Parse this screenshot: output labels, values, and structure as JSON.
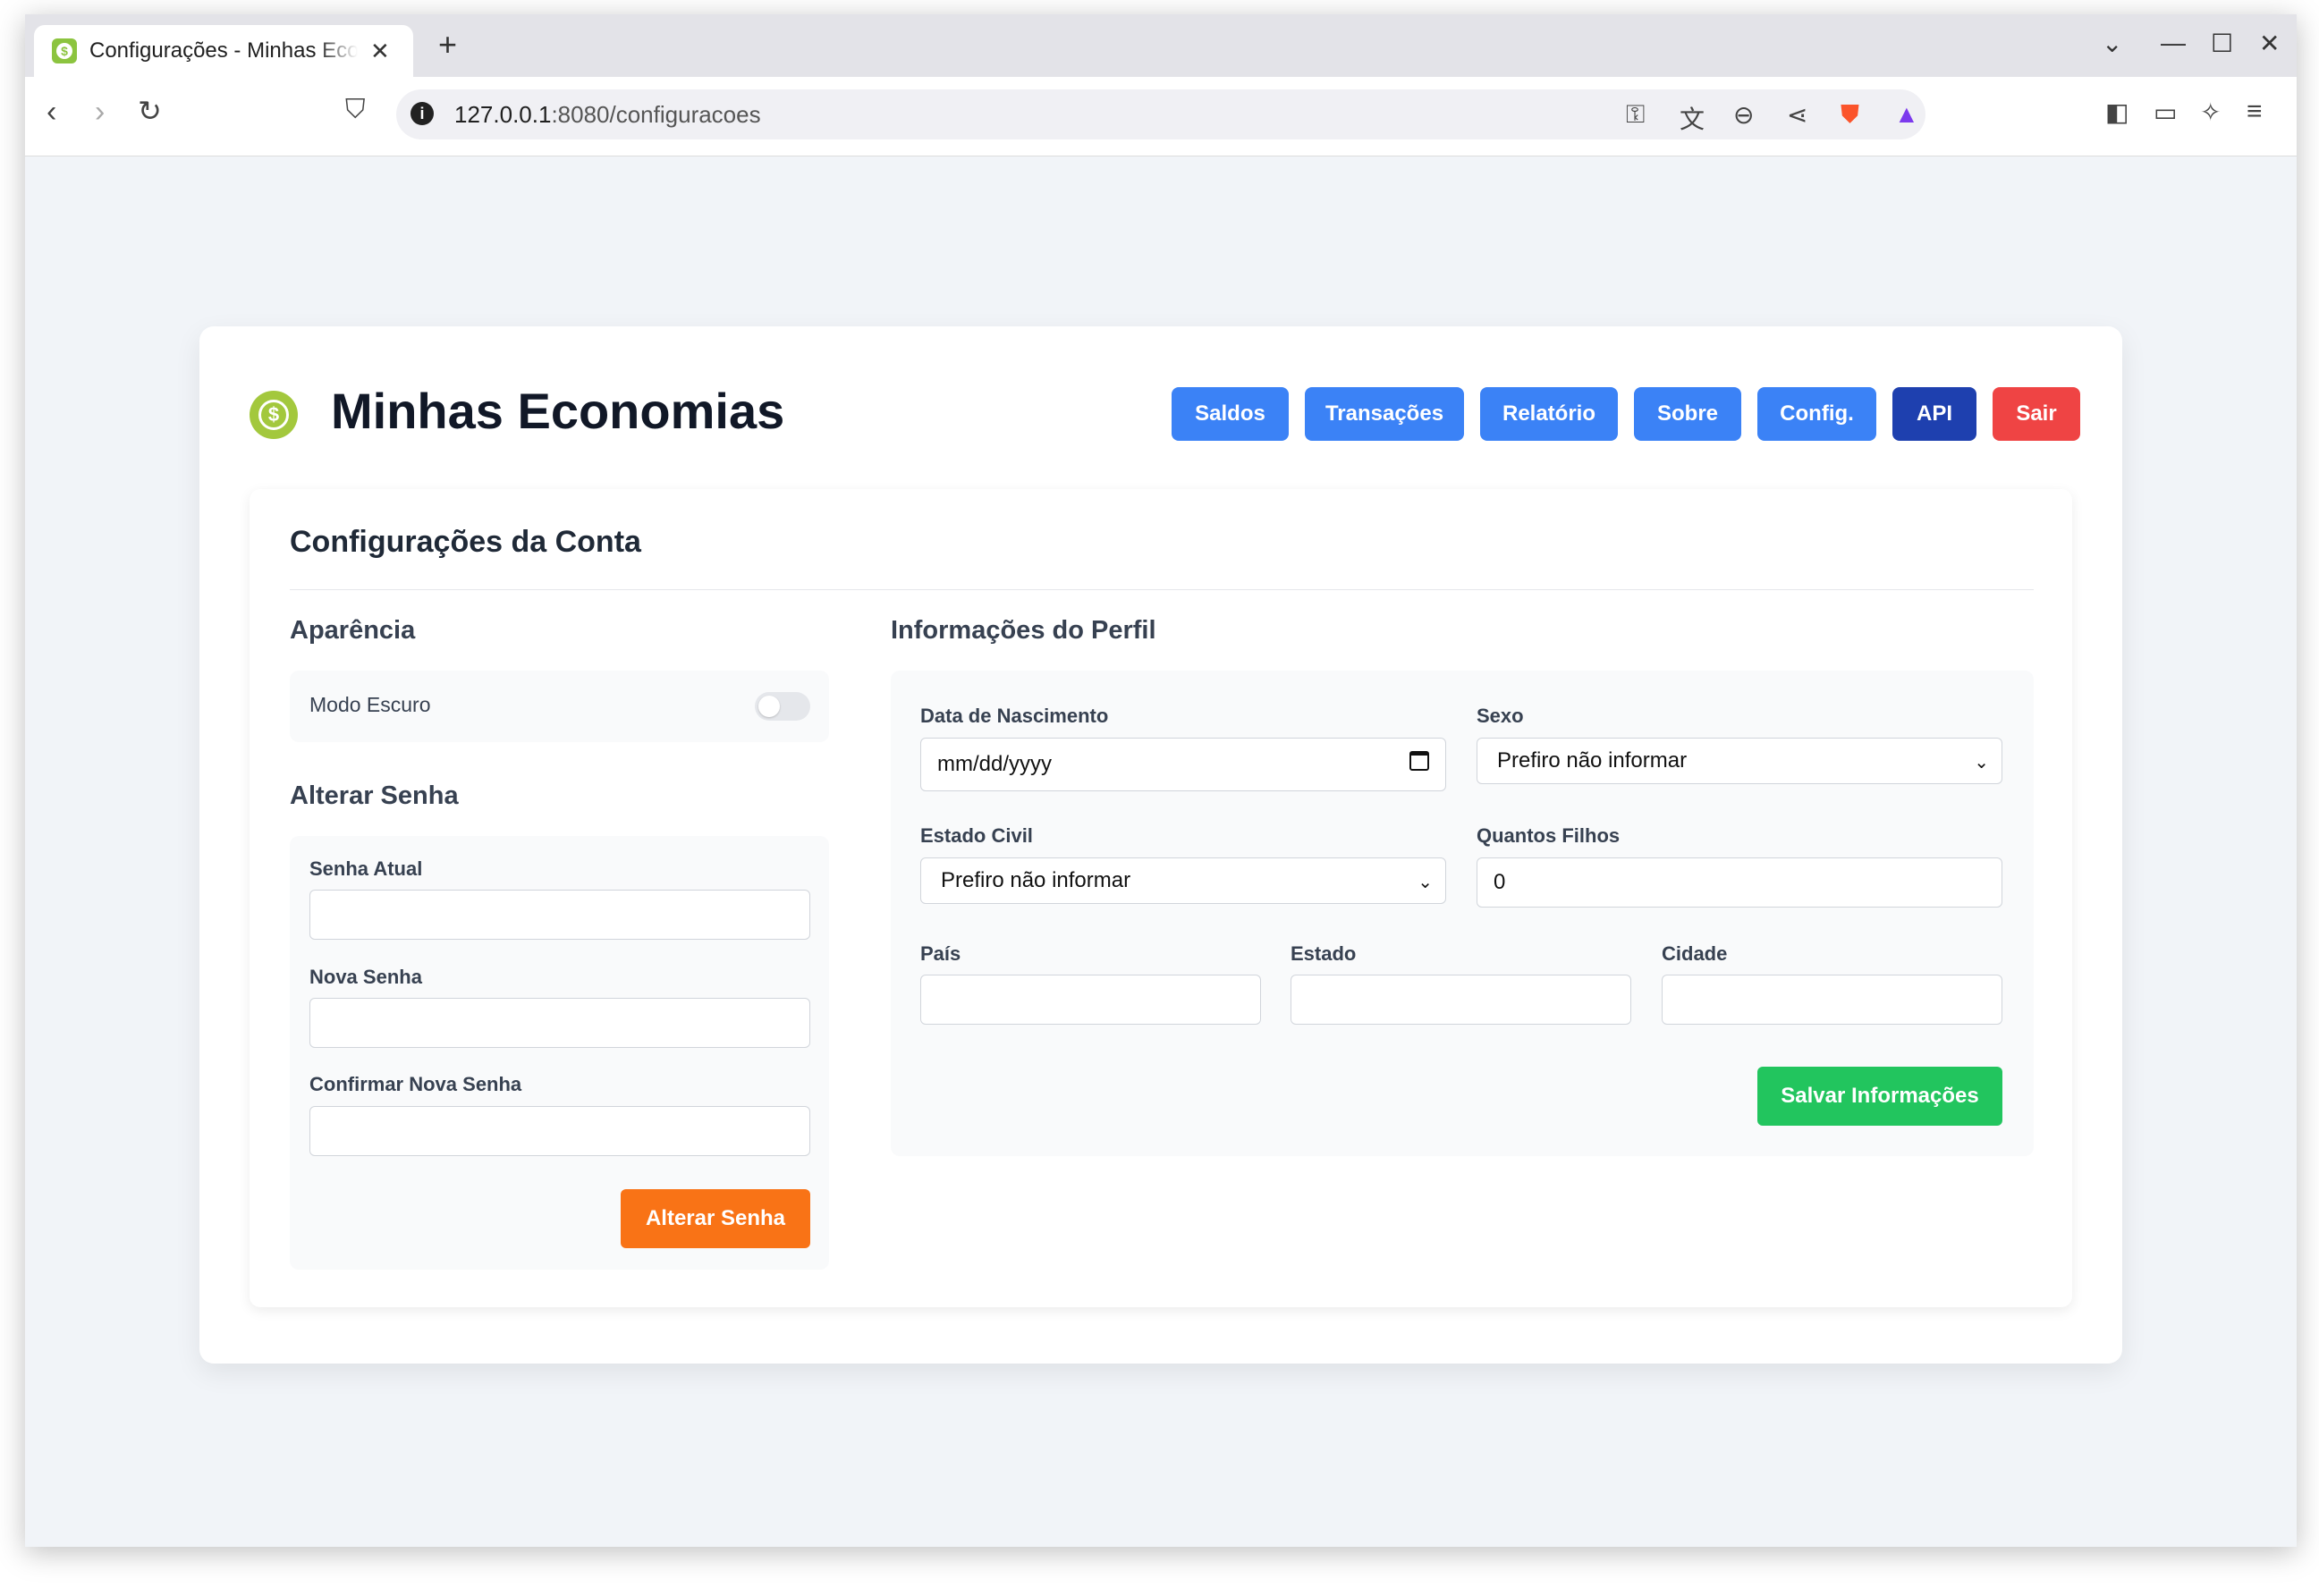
{
  "browser": {
    "tab_title": "Configurações - Minhas Economias",
    "tab_close": "✕",
    "new_tab": "+",
    "url_host": "127.0.0.1",
    "url_path": ":8080/configuracoes",
    "icons": [
      "back-icon",
      "forward-icon",
      "reload-icon",
      "bookmark-icon",
      "site-info-icon",
      "key-icon",
      "translate-icon",
      "zoom-icon",
      "share-icon",
      "brave-shields-icon",
      "brave-rewards-icon",
      "sidebar-icon",
      "wallet-icon",
      "leo-icon",
      "menu-icon"
    ]
  },
  "app": {
    "brand": "Minhas Economias",
    "nav": [
      {
        "label": "Saldos",
        "color": "#3b82f6"
      },
      {
        "label": "Transações",
        "color": "#3b82f6"
      },
      {
        "label": "Relatório",
        "color": "#3b82f6"
      },
      {
        "label": "Sobre",
        "color": "#3b82f6"
      },
      {
        "label": "Config.",
        "color": "#3b82f6"
      },
      {
        "label": "API",
        "color": "#1e40af"
      },
      {
        "label": "Sair",
        "color": "#ef4444"
      }
    ]
  },
  "settings": {
    "title": "Configurações da Conta",
    "appearance": {
      "heading": "Aparência",
      "dark_mode_label": "Modo Escuro",
      "dark_mode_on": false
    },
    "password": {
      "heading": "Alterar Senha",
      "current_label": "Senha Atual",
      "new_label": "Nova Senha",
      "confirm_label": "Confirmar Nova Senha",
      "submit": "Alterar Senha",
      "submit_color": "#f97316"
    },
    "profile": {
      "heading": "Informações do Perfil",
      "birth_label": "Data de Nascimento",
      "birth_placeholder": "mm/dd/yyyy",
      "sex_label": "Sexo",
      "sex_value": "Prefiro não informar",
      "civil_label": "Estado Civil",
      "civil_value": "Prefiro não informar",
      "children_label": "Quantos Filhos",
      "children_value": "0",
      "country_label": "País",
      "state_label": "Estado",
      "city_label": "Cidade",
      "submit": "Salvar Informações",
      "submit_color": "#22c55e"
    }
  }
}
